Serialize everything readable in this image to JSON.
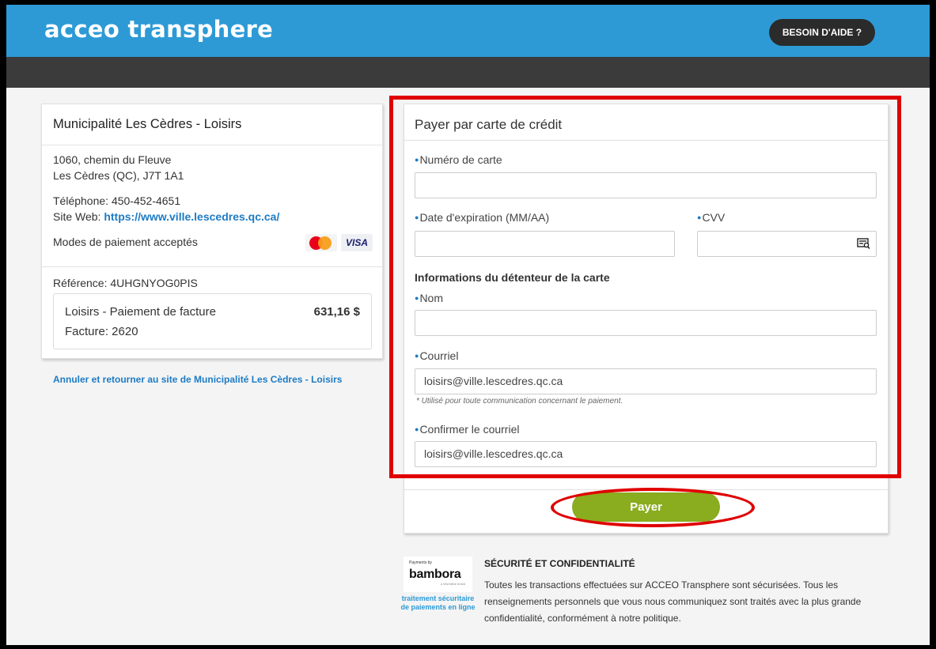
{
  "header": {
    "logo": "acceo transphere",
    "help_button": "BESOIN D'AIDE ?"
  },
  "merchant": {
    "name": "Municipalité Les Cèdres - Loisirs",
    "address_line1": "1060, chemin du Fleuve",
    "address_line2": "Les Cèdres (QC), J7T 1A1",
    "phone": "Téléphone: 450-452-4651",
    "website_label": "Site Web:",
    "website_url": "https://www.ville.lescedres.qc.ca/",
    "payment_modes": "Modes de paiement acceptés",
    "card_brands": [
      "MasterCard",
      "VISA"
    ],
    "reference": "Référence: 4UHGNYOG0PIS",
    "invoice": {
      "description": "Loisirs - Paiement de facture",
      "number": "Facture: 2620",
      "amount": "631,16 $"
    },
    "cancel_link": "Annuler et retourner au site de Municipalité Les Cèdres - Loisirs"
  },
  "payment_form": {
    "title": "Payer par carte de crédit",
    "card_number": {
      "label": "Numéro de carte",
      "value": ""
    },
    "expiry": {
      "label": "Date d'expiration (MM/AA)",
      "value": ""
    },
    "cvv": {
      "label": "CVV",
      "value": ""
    },
    "holder_section": "Informations du détenteur de la carte",
    "name": {
      "label": "Nom",
      "value": ""
    },
    "email": {
      "label": "Courriel",
      "value": "loisirs@ville.lescedres.qc.ca"
    },
    "email_note": "* Utilisé pour toute communication concernant le paiement.",
    "confirm_email": {
      "label": "Confirmer le courriel",
      "value": "loisirs@ville.lescedres.qc.ca"
    },
    "pay_button": "Payer"
  },
  "security": {
    "bambora_small": "Payments by",
    "bambora_name": "bambora",
    "bambora_sub": "a Worldline brand",
    "bambora_caption": "traitement sécuritaire de paiements en ligne",
    "title": "SÉCURITÉ ET CONFIDENTIALITÉ",
    "text": "Toutes les transactions effectuées sur ACCEO Transphere sont sécurisées. Tous les renseignements personnels que vous nous communiquez sont traités avec la plus grande confidentialité, conformément à notre politique."
  },
  "colors": {
    "brand_blue": "#2d9ad6",
    "dark_bar": "#3b3b3b",
    "pay_green": "#8aac1f",
    "highlight_red": "#e00000"
  }
}
